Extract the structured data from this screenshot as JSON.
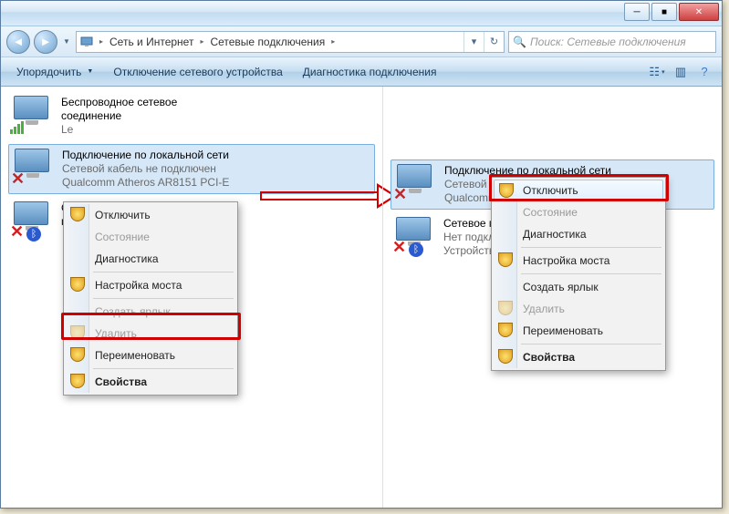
{
  "titlebar": {
    "minimize": "─",
    "maximize": "■",
    "close": "✕"
  },
  "nav": {
    "back": "◄",
    "fwd": "►"
  },
  "address": {
    "seg1": "Сеть и Интернет",
    "seg2": "Сетевые подключения"
  },
  "search": {
    "placeholder": "Поиск: Сетевые подключения"
  },
  "toolbar": {
    "organize": "Упорядочить",
    "disable_device": "Отключение сетевого устройства",
    "diagnose": "Диагностика подключения"
  },
  "left": {
    "wifi": {
      "title": "Беспроводное сетевое",
      "title2": "соединение",
      "sub": "Le"
    },
    "lan": {
      "title": "Подключение по локальной сети",
      "sub1": "Сетевой кабель не подключен",
      "sub2": "Qualcomm Atheros AR8151 PCI-E"
    },
    "bt": {
      "title": "Сетевое",
      "title2": "подключение"
    }
  },
  "right": {
    "lan": {
      "title": "Подключение по локальной сети",
      "sub1": "Сетевой ка",
      "sub2": "Qualcomm"
    },
    "bt": {
      "title": "Сетевое п",
      "sub1": "Нет подкл",
      "sub2": "Устройств"
    }
  },
  "menu": {
    "disable": "Отключить",
    "status": "Состояние",
    "diag": "Диагностика",
    "bridge": "Настройка моста",
    "shortcut": "Создать ярлык",
    "delete": "Удалить",
    "rename": "Переименовать",
    "props": "Свойства"
  }
}
